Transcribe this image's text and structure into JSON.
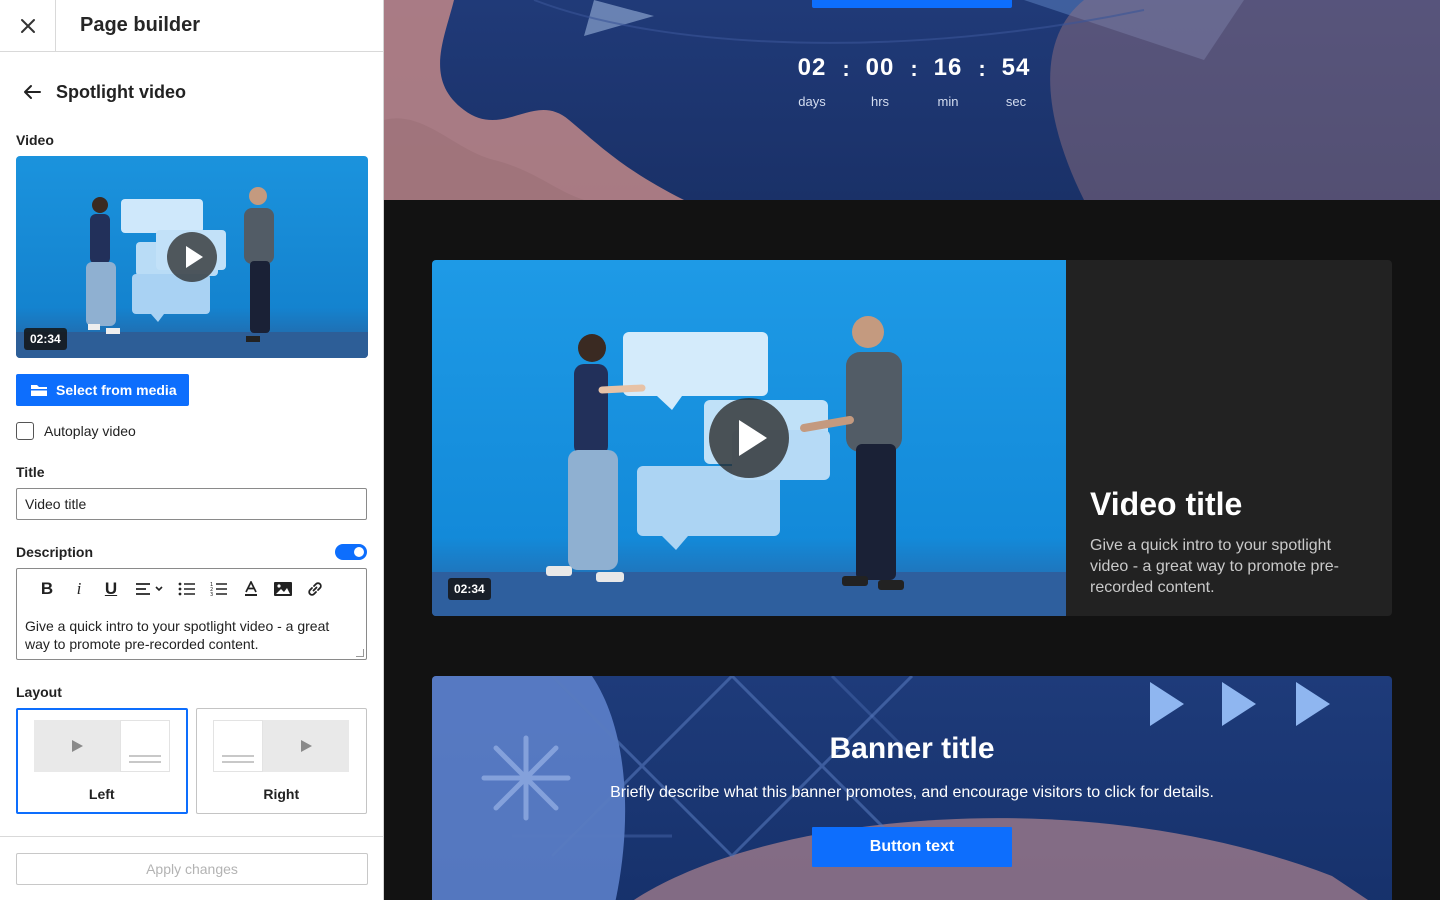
{
  "sidebar": {
    "title": "Page builder",
    "subtitle": "Spotlight video",
    "video_label": "Video",
    "video_duration": "02:34",
    "select_media_label": "Select from media",
    "autoplay_label": "Autoplay video",
    "autoplay_checked": false,
    "title_label": "Title",
    "title_value": "Video title",
    "description_label": "Description",
    "description_enabled": true,
    "description_value": "Give a quick intro to your spotlight video - a great way to promote pre-recorded content.",
    "layout_label": "Layout",
    "layouts": [
      {
        "label": "Left",
        "selected": true
      },
      {
        "label": "Right",
        "selected": false
      }
    ],
    "apply_label": "Apply changes"
  },
  "preview": {
    "countdown": {
      "days": "02",
      "days_label": "days",
      "hrs": "00",
      "hrs_label": "hrs",
      "min": "16",
      "min_label": "min",
      "sec": "54",
      "sec_label": "sec"
    },
    "spotlight": {
      "title": "Video title",
      "description": "Give a quick intro to your spotlight video - a great way to promote pre-recorded content.",
      "duration": "02:34"
    },
    "banner": {
      "title": "Banner title",
      "description": "Briefly describe what this banner promotes, and encourage visitors to click for details.",
      "button_label": "Button text"
    }
  },
  "colors": {
    "accent": "#0d6efd",
    "preview_bg": "#121212",
    "hero_bg": "#1a3168",
    "card_bg": "#222222"
  }
}
